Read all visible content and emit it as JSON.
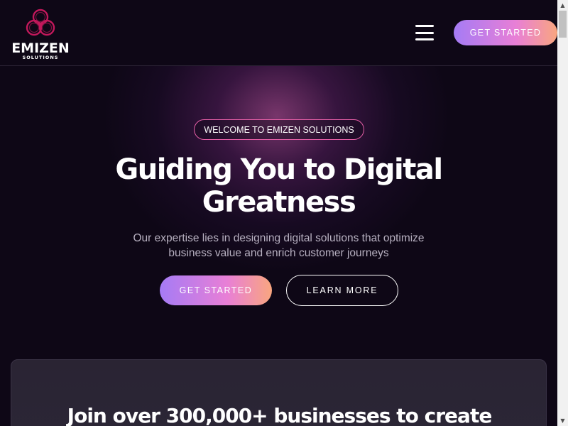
{
  "header": {
    "logo_text": "EMIZEN",
    "logo_subtext": "SOLUTIONS",
    "menu_icon": "hamburger-menu-icon",
    "cta_label": "GET STARTED"
  },
  "hero": {
    "badge": "WELCOME TO EMIZEN SOLUTIONS",
    "title_line1": "Guiding You to Digital",
    "title_line2": "Greatness",
    "subtitle_line1": "Our expertise lies in designing digital solutions that optimize",
    "subtitle_line2": "business value and enrich customer journeys",
    "primary_button": "GET STARTED",
    "secondary_button": "LEARN MORE"
  },
  "card": {
    "title": "Join over 300,000+ businesses to create"
  },
  "colors": {
    "background": "#0e0716",
    "accent_gradient_start": "#a57bf5",
    "accent_gradient_mid": "#e87fd6",
    "accent_gradient_end": "#f9a67f",
    "badge_border": "#e35ea6",
    "logo_magenta": "#c2185b"
  }
}
